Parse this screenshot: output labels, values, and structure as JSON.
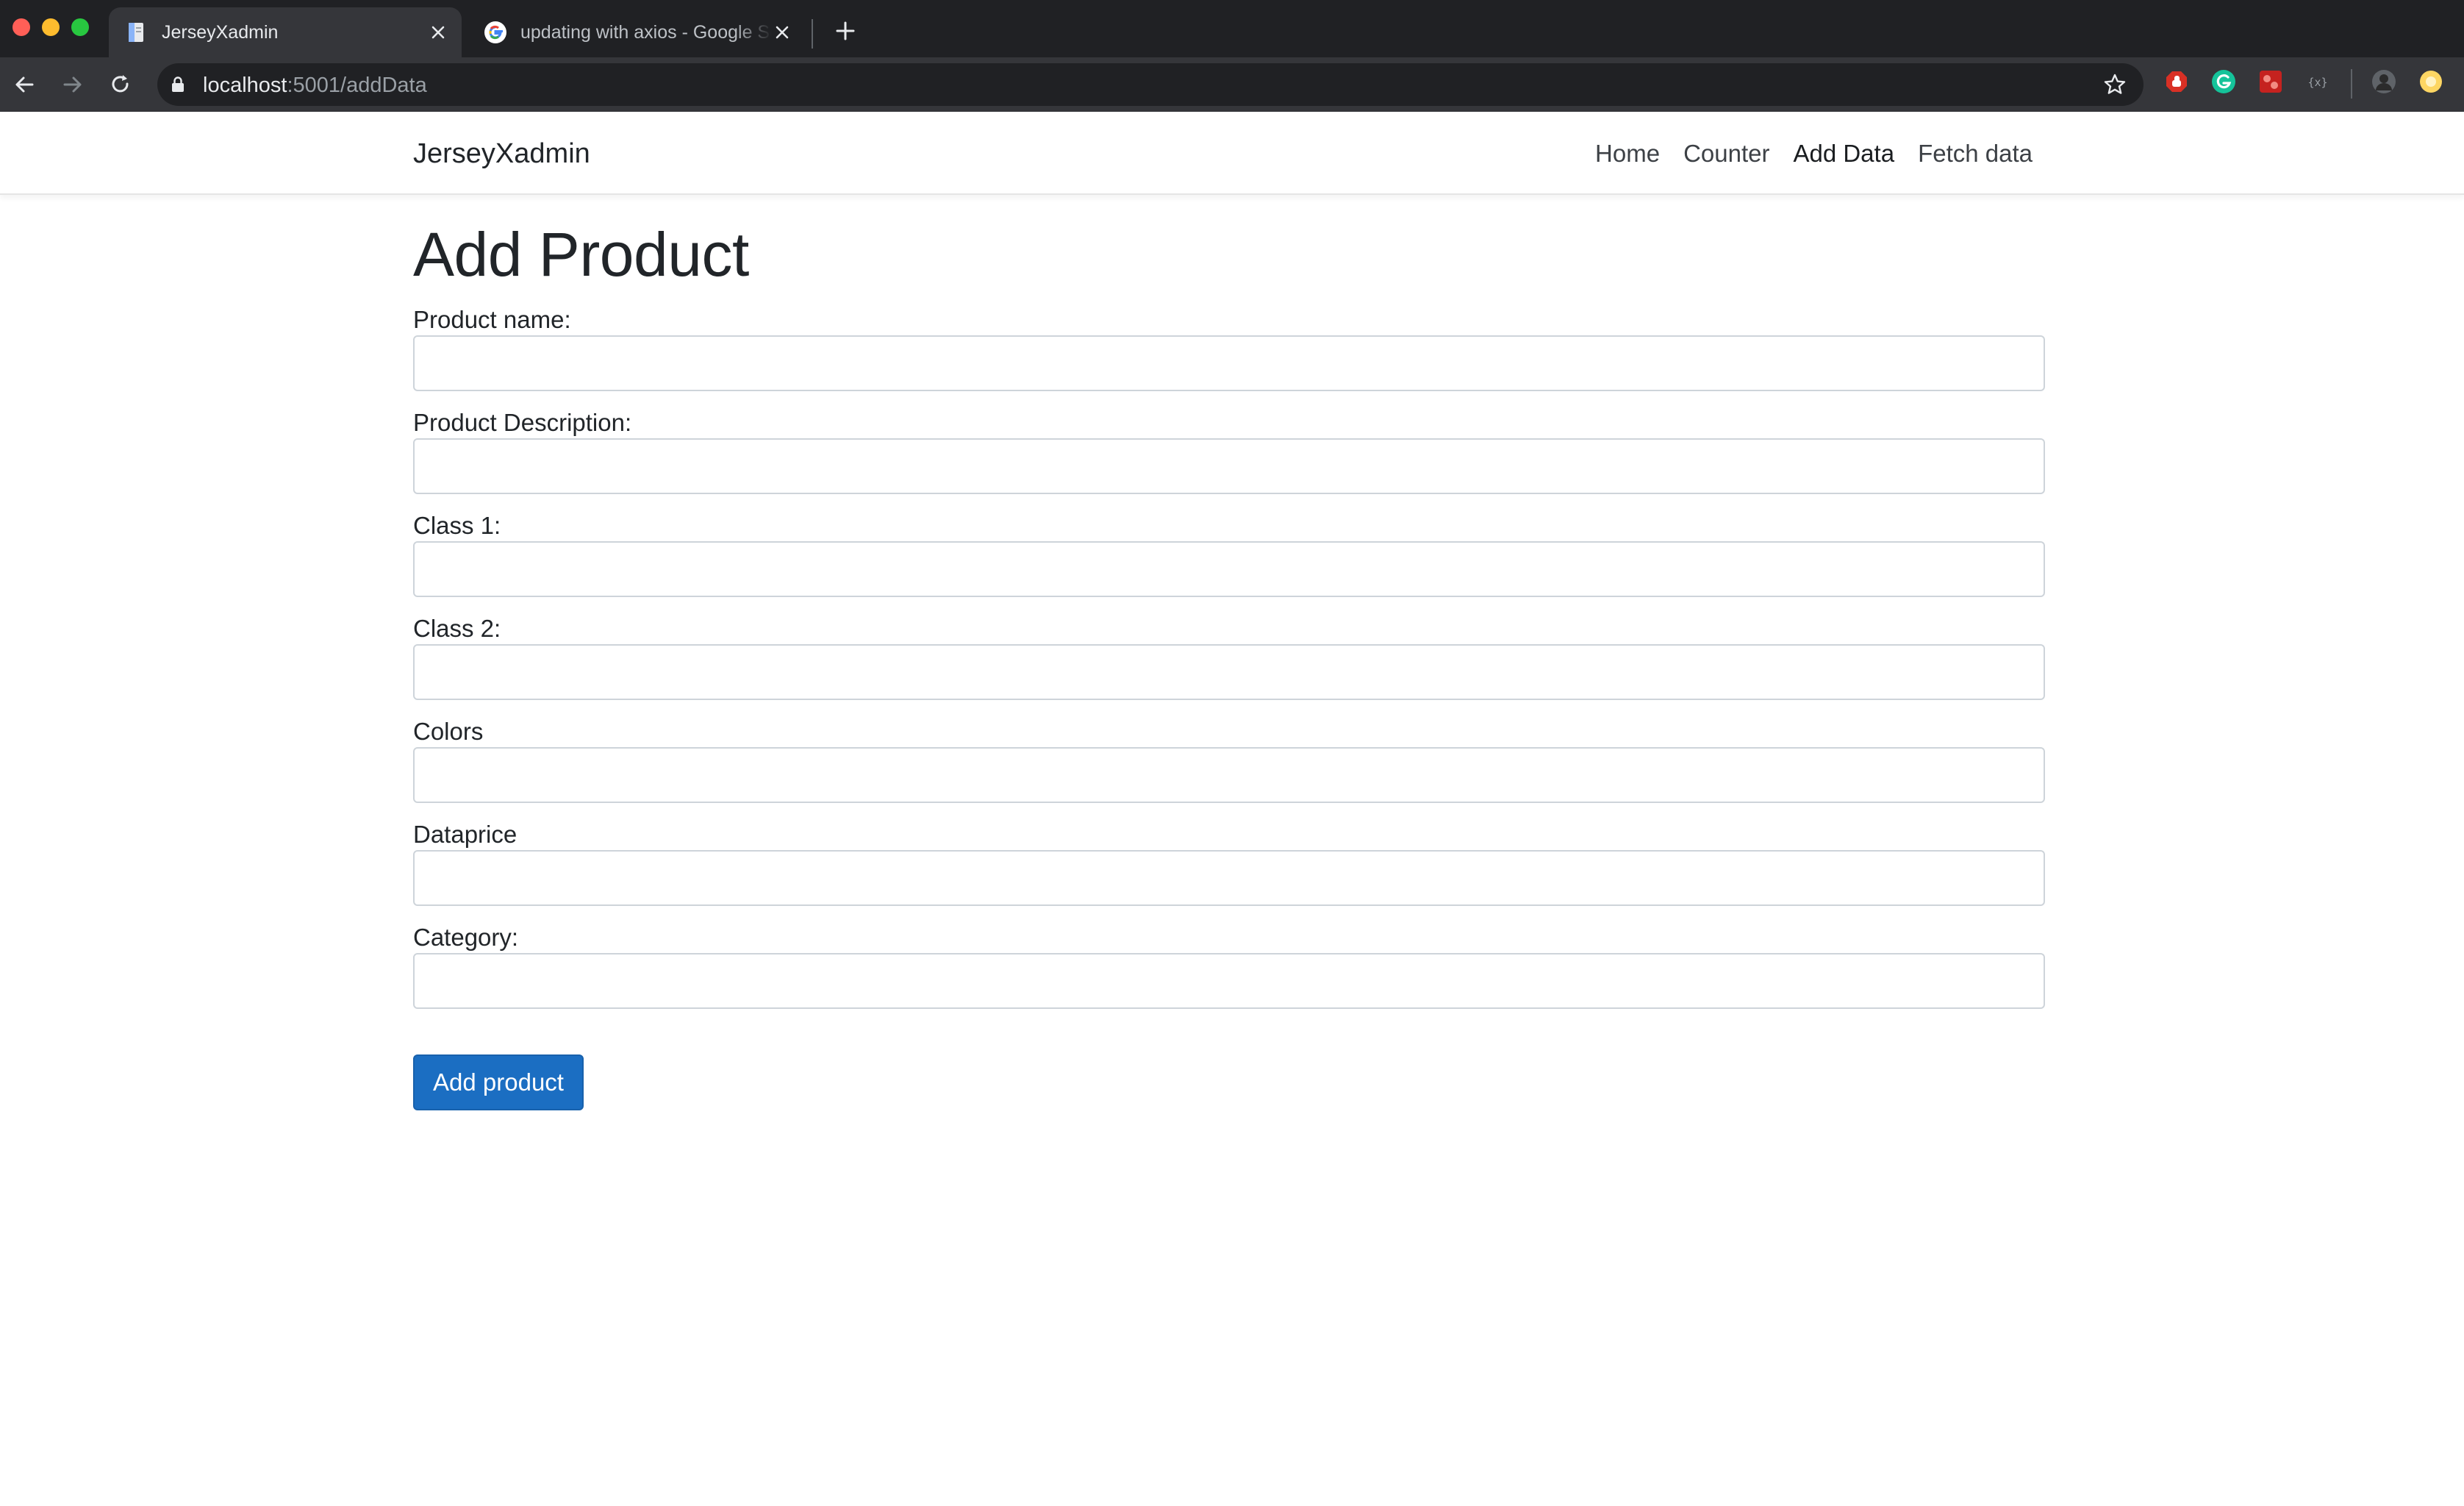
{
  "browser": {
    "tabs": [
      {
        "title": "JerseyXadmin",
        "active": true
      },
      {
        "title": "updating with axios - Google Search",
        "active": false
      }
    ],
    "url": {
      "host": "localhost",
      "path": ":5001/addData"
    }
  },
  "navbar": {
    "brand": "JerseyXadmin",
    "links": [
      {
        "label": "Home"
      },
      {
        "label": "Counter"
      },
      {
        "label": "Add Data",
        "active": true
      },
      {
        "label": "Fetch data"
      }
    ]
  },
  "form": {
    "title": "Add Product",
    "fields": [
      {
        "label": "Product name:",
        "value": ""
      },
      {
        "label": "Product Description:",
        "value": ""
      },
      {
        "label": "Class 1:",
        "value": ""
      },
      {
        "label": "Class 2:",
        "value": ""
      },
      {
        "label": "Colors",
        "value": ""
      },
      {
        "label": "Dataprice",
        "value": ""
      },
      {
        "label": "Category:",
        "value": ""
      }
    ],
    "submit_label": "Add product"
  },
  "colors": {
    "primary": "#1b6ec2",
    "chrome_dark": "#202124",
    "chrome_toolbar": "#35363a"
  }
}
